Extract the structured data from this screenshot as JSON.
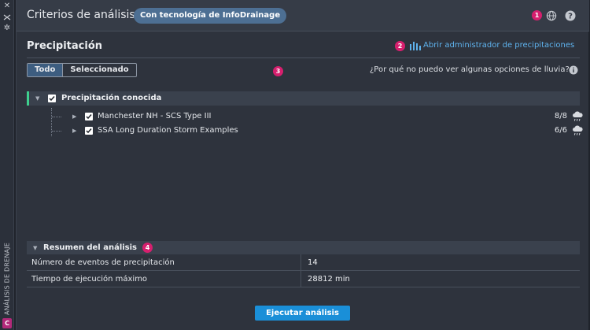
{
  "sidebar_strip": {
    "vertical_label": "ANÁLISIS DE DRENAJE",
    "badge": "C",
    "icons": [
      "close-icon",
      "collapse-icon",
      "settings-icon"
    ]
  },
  "header": {
    "title": "Criterios de análisis",
    "badge": "Con tecnología de InfoDrainage",
    "markers": [
      "1"
    ],
    "icons": [
      "globe-icon",
      "help-icon"
    ]
  },
  "section": {
    "title": "Precipitación",
    "link_marker": "2",
    "link": "Abrir administrador de precipitaciones",
    "filter_marker": "3",
    "segments": [
      "Todo",
      "Seleccionado"
    ],
    "active_segment": "Todo",
    "why_text": "¿Por qué no puedo ver algunas opciones de lluvia?"
  },
  "tree": {
    "group_label": "Precipitación conocida",
    "items": [
      {
        "label": "Manchester NH - SCS Type III",
        "count": "8/8"
      },
      {
        "label": "SSA Long Duration Storm Examples",
        "count": "6/6"
      }
    ]
  },
  "summary": {
    "title": "Resumen del análisis",
    "marker": "4",
    "rows": [
      {
        "key": "Número de eventos de precipitación",
        "value": "14"
      },
      {
        "key": "Tiempo de ejecución máximo",
        "value": "28812 min"
      }
    ]
  },
  "actions": {
    "run": "Ejecutar análisis"
  },
  "colors": {
    "accent": "#1a8fd8",
    "marker": "#d61f6e",
    "link": "#5fb3ee",
    "group_bar": "#3ecf8e"
  }
}
